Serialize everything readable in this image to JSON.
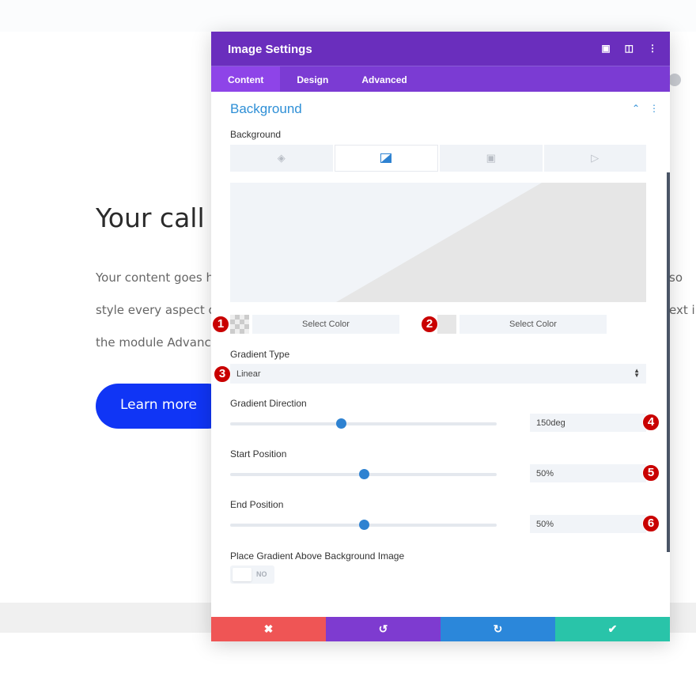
{
  "page": {
    "heading": "Your call t",
    "para_lines": [
      "Your content goes h",
      "style every aspect of",
      "the module Advance"
    ],
    "right_fragments": [
      "so",
      "ext in"
    ],
    "button": "Learn more"
  },
  "modal": {
    "title": "Image Settings",
    "header_icons": [
      "focus-icon",
      "split-view-icon",
      "more-vertical-icon"
    ],
    "tabs": [
      {
        "label": "Content",
        "active": true
      },
      {
        "label": "Design"
      },
      {
        "label": "Advanced"
      }
    ],
    "section_title": "Background",
    "background_label": "Background",
    "background_types": [
      "color-icon",
      "gradient-icon",
      "image-icon",
      "video-icon"
    ],
    "active_background_type": "gradient",
    "color1": {
      "badge": "1",
      "label": "Select Color"
    },
    "color2": {
      "badge": "2",
      "label": "Select Color",
      "swatch": "#e6e6e6"
    },
    "gradient_type": {
      "label": "Gradient Type",
      "value": "Linear",
      "badge": "3"
    },
    "gradient_direction": {
      "label": "Gradient Direction",
      "value": "150deg",
      "degrees": 150,
      "max": 360,
      "badge": "4"
    },
    "start_position": {
      "label": "Start Position",
      "value": "50%",
      "percent": 50,
      "badge": "5"
    },
    "end_position": {
      "label": "End Position",
      "value": "50%",
      "percent": 50,
      "badge": "6"
    },
    "place_above": {
      "label": "Place Gradient Above Background Image",
      "toggle": "NO"
    },
    "footer": [
      "close-icon",
      "undo-icon",
      "redo-icon",
      "check-icon"
    ]
  },
  "colors": {
    "header": "#6a2ebd",
    "tabs": "#7b3bd3",
    "accent": "#2e8fd6",
    "cancel": "#ef5555",
    "undo": "#7e3bd0",
    "redo": "#2b87da",
    "save": "#29c4a9",
    "cta": "#1035f5",
    "badge": "#c90000"
  }
}
